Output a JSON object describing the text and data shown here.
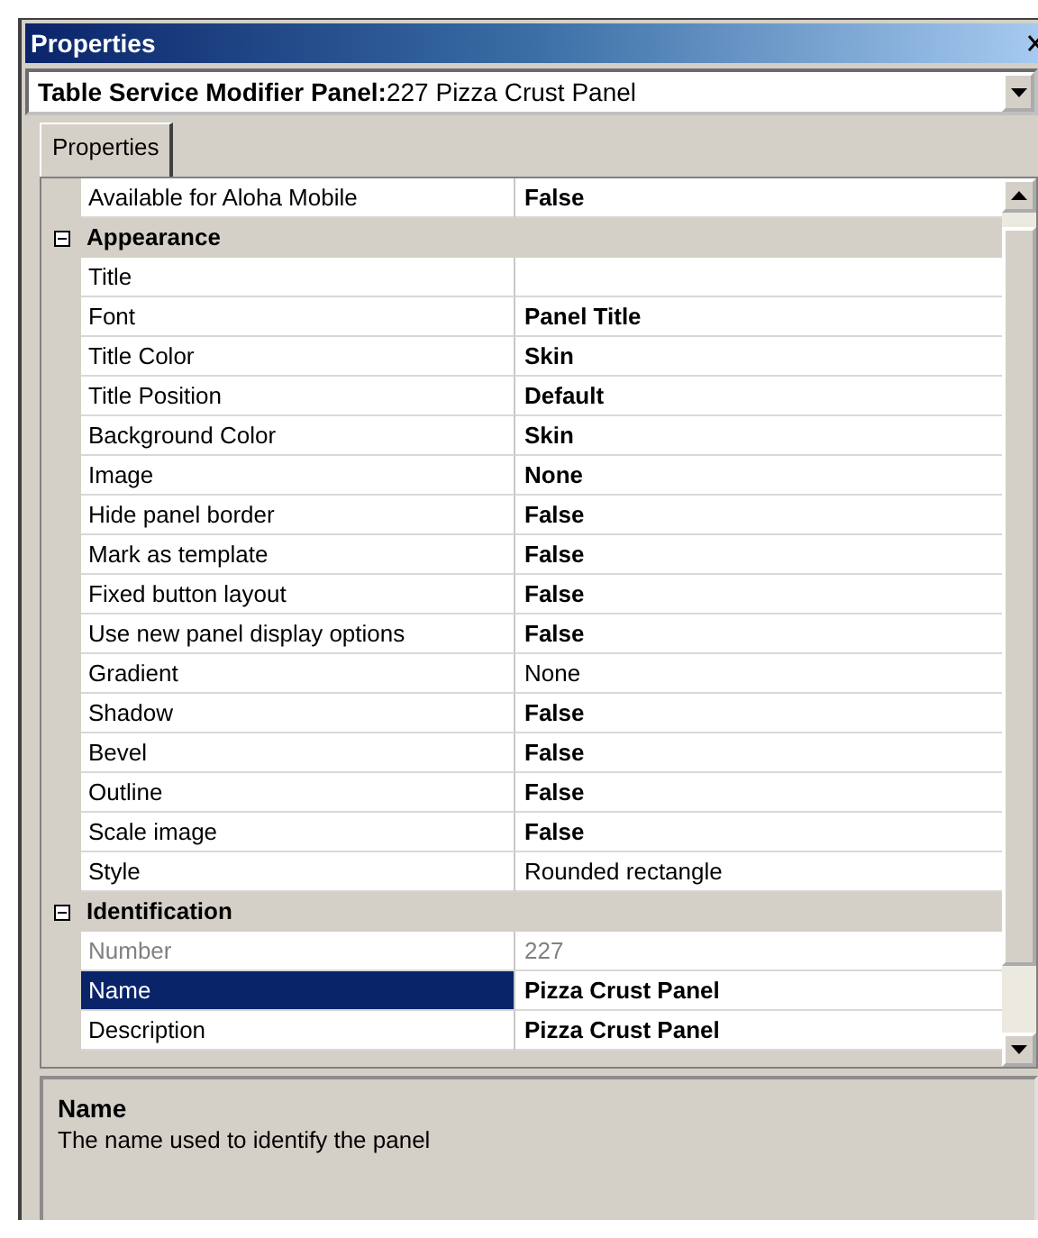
{
  "window": {
    "title": "Properties"
  },
  "object_selector": {
    "value": "**Table Service Modifier Panel:**227 Pizza Crust Panel"
  },
  "tabs": [
    {
      "label": "Properties",
      "selected": true
    }
  ],
  "grid": {
    "items": [
      {
        "kind": "property",
        "name": "Available for Aloha Mobile",
        "value": "False",
        "modified": true,
        "disabled": false,
        "selected": false
      },
      {
        "kind": "category",
        "name": "Appearance",
        "expanded": true,
        "children": [
          {
            "kind": "property",
            "name": "Title",
            "modified": true,
            "disabled": false,
            "selected": false
          },
          {
            "kind": "property",
            "name": "Font",
            "value": "Panel Title",
            "modified": true,
            "disabled": false,
            "selected": false
          },
          {
            "kind": "property",
            "name": "Title Color",
            "value": "Skin",
            "modified": true,
            "disabled": false,
            "selected": false
          },
          {
            "kind": "property",
            "name": "Title Position",
            "value": "Default",
            "modified": true,
            "disabled": false,
            "selected": false
          },
          {
            "kind": "property",
            "name": "Background Color",
            "value": "Skin",
            "modified": true,
            "disabled": false,
            "selected": false
          },
          {
            "kind": "property",
            "name": "Image",
            "value": "None",
            "modified": true,
            "disabled": false,
            "selected": false
          },
          {
            "kind": "property",
            "name": "Hide panel border",
            "value": "False",
            "modified": true,
            "disabled": false,
            "selected": false
          },
          {
            "kind": "property",
            "name": "Mark as template",
            "value": "False",
            "modified": true,
            "disabled": false,
            "selected": false
          },
          {
            "kind": "property",
            "name": "Fixed button layout",
            "value": "False",
            "modified": true,
            "disabled": false,
            "selected": false
          },
          {
            "kind": "property",
            "name": "Use new panel display options",
            "value": "False",
            "modified": true,
            "disabled": false,
            "selected": false
          },
          {
            "kind": "property",
            "name": "Gradient",
            "value": "None",
            "modified": false,
            "disabled": false,
            "selected": false
          },
          {
            "kind": "property",
            "name": "Shadow",
            "value": "False",
            "modified": true,
            "disabled": false,
            "selected": false
          },
          {
            "kind": "property",
            "name": "Bevel",
            "value": "False",
            "modified": true,
            "disabled": false,
            "selected": false
          },
          {
            "kind": "property",
            "name": "Outline",
            "value": "False",
            "modified": true,
            "disabled": false,
            "selected": false
          },
          {
            "kind": "property",
            "name": "Scale image",
            "value": "False",
            "modified": true,
            "disabled": false,
            "selected": false
          },
          {
            "kind": "property",
            "name": "Style",
            "value": "Rounded rectangle",
            "modified": false,
            "disabled": false,
            "selected": false
          }
        ]
      },
      {
        "kind": "category",
        "name": "Identification",
        "expanded": true,
        "children": [
          {
            "kind": "property",
            "name": "Number",
            "value": "227",
            "modified": false,
            "disabled": true,
            "selected": false
          },
          {
            "kind": "property",
            "name": "Name",
            "value": "Pizza Crust Panel",
            "modified": true,
            "disabled": false,
            "selected": true
          },
          {
            "kind": "property",
            "name": "Description",
            "value": "Pizza Crust Panel",
            "modified": true,
            "disabled": false,
            "selected": false
          }
        ]
      }
    ]
  },
  "description": {
    "title": "Name",
    "text": "The name used to identify the panel"
  }
}
